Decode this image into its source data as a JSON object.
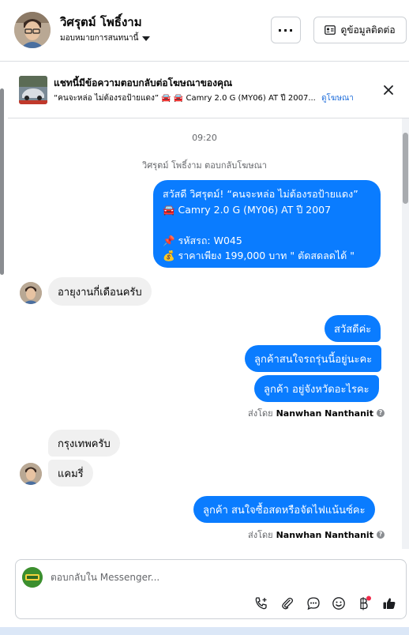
{
  "header": {
    "user_name": "วิศรุตม์ โพธิ์งาม",
    "assign_label": "มอบหมายการสนทนานี้",
    "more_label": "···",
    "contact_label": "ดูข้อมูลติดต่อ"
  },
  "ad_banner": {
    "title": "แชทนี้มีข้อความตอบกลับต่อโฆษณาของคุณ",
    "subtitle": "“คนจะหล่อ ไม่ต้องรอป้ายแดง” 🚘 🚘 Camry 2.0 G (MY06) AT ปี 2007...",
    "link_label": "ดูโฆษณา"
  },
  "conversation": {
    "timestamp": "09:20",
    "reply_note": "วิศรุตม์ โพธิ์งาม ตอบกลับโฆษณา",
    "ad_message_lines": [
      "สวัสดี วิศรุตม์! “คนจะหล่อ ไม่ต้องรอป้ายแดง”",
      "🚘 Camry 2.0 G (MY06) AT ปี 2007",
      "",
      "📌 รหัสรถ: W045",
      "💰 ราคาเพียง 199,000 บาท \" ตัดสดลดได้ \""
    ],
    "msg_in_1": "อายุงานกี่เดือนครับ",
    "msg_out_1": "สวัสดีค่ะ",
    "msg_out_2": "ลูกค้าสนใจรถรุ่นนี้อยู่นะคะ",
    "msg_out_3": "ลูกค้า อยู่จังหวัดอะไรคะ",
    "sent_by_prefix": "ส่งโดย",
    "sent_by_name": "Nanwhan Nanthanit",
    "msg_in_2": "กรุงเทพครับ",
    "msg_in_3": "แคมรี่",
    "msg_out_4": "ลูกค้า สนใจซื้อสดหรือจัดไฟแน้นซ์คะ"
  },
  "composer": {
    "placeholder": "ตอบกลับใน Messenger..."
  },
  "colors": {
    "outgoing_bubble": "#0a7cff",
    "incoming_bubble": "#f0f0f0",
    "link": "#216fdb",
    "notification_dot": "#f02849"
  },
  "icons": [
    "more-icon",
    "contact-card-icon",
    "close-icon",
    "call-add-icon",
    "attach-icon",
    "saved-reply-icon",
    "emoji-icon",
    "payment-icon",
    "thumbs-up-icon"
  ]
}
